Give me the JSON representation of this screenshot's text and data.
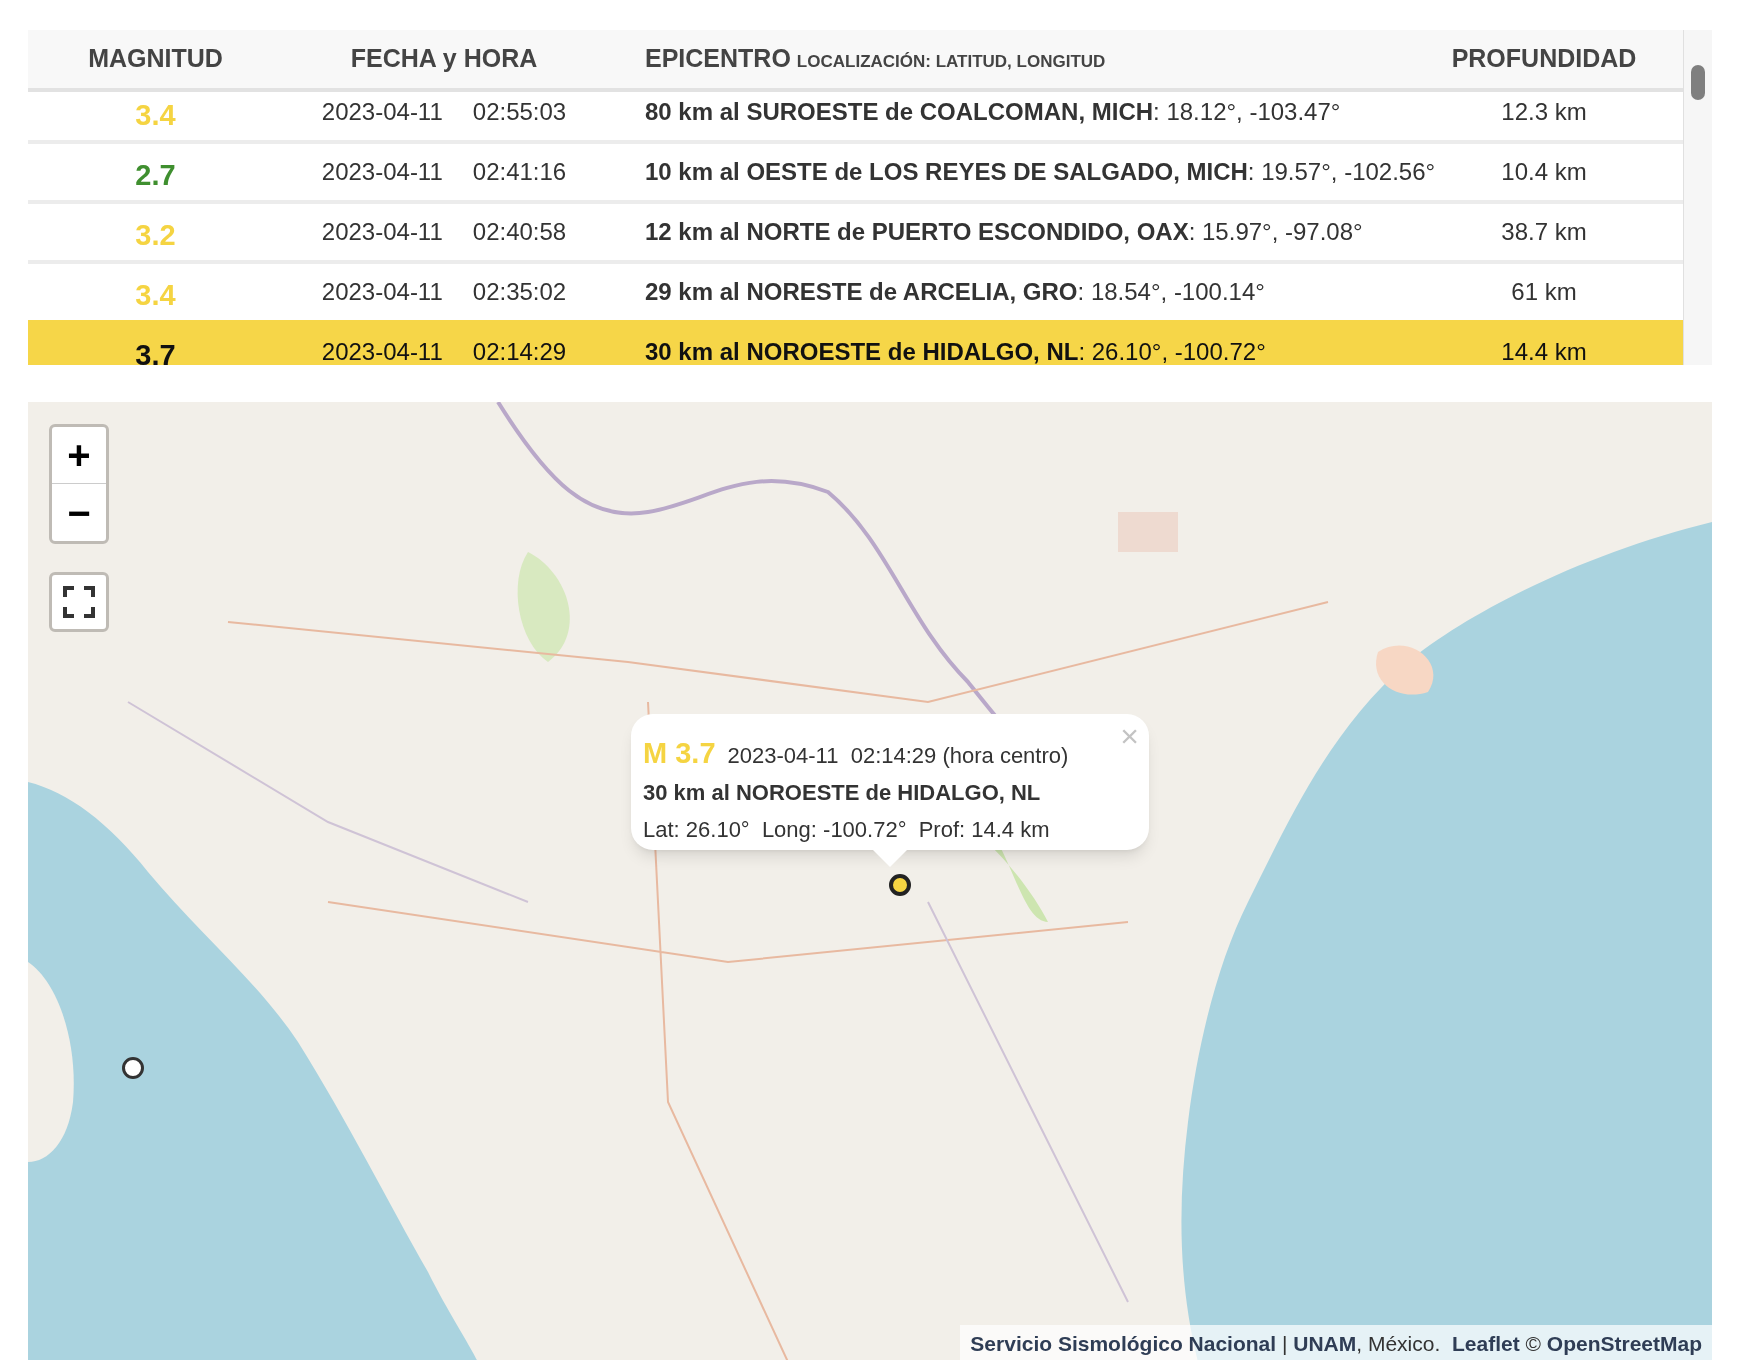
{
  "table": {
    "columns": [
      {
        "label": "MAGNITUD"
      },
      {
        "label": "FECHA y HORA"
      },
      {
        "label": "EPICENTRO",
        "sublabel": "LOCALIZACIÓN: LATITUD, LONGITUD"
      },
      {
        "label": "PROFUNDIDAD"
      }
    ],
    "rows": [
      {
        "magnitude": "3.4",
        "color": "#f5d442",
        "date": "2023-04-11",
        "time": "02:55:03",
        "epicenter": "**80 km al SUROESTE de COALCOMAN, MICH**: 18.12°, -103.47°",
        "depth": "12.3 km",
        "selected": false
      },
      {
        "magnitude": "2.7",
        "color": "#3f8f2f",
        "date": "2023-04-11",
        "time": "02:41:16",
        "epicenter": "**10 km al OESTE de LOS REYES DE SALGADO, MICH**: 19.57°, -102.56°",
        "depth": "10.4 km",
        "selected": false
      },
      {
        "magnitude": "3.2",
        "color": "#f5d442",
        "date": "2023-04-11",
        "time": "02:40:58",
        "epicenter": "**12 km al NORTE de PUERTO ESCONDIDO, OAX**: 15.97°, -97.08°",
        "depth": "38.7 km",
        "selected": false
      },
      {
        "magnitude": "3.4",
        "color": "#f5d442",
        "date": "2023-04-11",
        "time": "02:35:02",
        "epicenter": "**29 km al NORESTE de ARCELIA, GRO**: 18.54°, -100.14°",
        "depth": "61 km",
        "selected": false
      },
      {
        "magnitude": "3.7",
        "date": "2023-04-11",
        "time": "02:14:29",
        "epicenter": "**30 km al NOROESTE de HIDALGO, NL**: 26.10°, -100.72°",
        "depth": "14.4 km",
        "selected": true
      }
    ]
  },
  "map": {
    "zoom_in": "+",
    "zoom_out": "−",
    "popup": {
      "magnitude": "M 3.7",
      "datetime": "2023-04-11  02:14:29 (hora centro)",
      "epicenter": "30 km al NOROESTE de HIDALGO, NL",
      "coords": "Lat: 26.10°  Long: -100.72°  Prof: 14.4 km",
      "close": "×"
    },
    "markers": [
      {
        "color": "#f5d442",
        "selected": true
      },
      {
        "color": "#ffffff",
        "selected": false
      }
    ],
    "attribution": "**Servicio Sismológico Nacional** | **UNAM**, México.  **Leaflet** © **OpenStreetMap**"
  }
}
